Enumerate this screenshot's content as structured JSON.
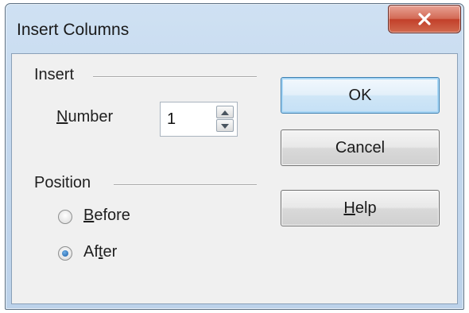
{
  "window": {
    "title": "Insert Columns",
    "close_glyph": "X"
  },
  "insert_group": {
    "title": "Insert",
    "number_label_underline": "N",
    "number_label_rest": "umber",
    "number_value": "1"
  },
  "position_group": {
    "title": "Position",
    "options": [
      {
        "underline": "B",
        "rest": "efore",
        "checked": false
      },
      {
        "pre": "Af",
        "underline": "t",
        "rest": "er",
        "checked": true
      }
    ]
  },
  "buttons": {
    "ok": "OK",
    "cancel": "Cancel",
    "help_underline": "H",
    "help_rest": "elp"
  },
  "icons": {
    "close": "close-icon",
    "spin_up": "arrow-up-icon",
    "spin_down": "arrow-down-icon"
  },
  "colors": {
    "titlebar": "#c4d8ee",
    "close_button": "#c2402a",
    "dialog_body": "#f0f0f0",
    "default_button_border": "#3c7fb1"
  }
}
